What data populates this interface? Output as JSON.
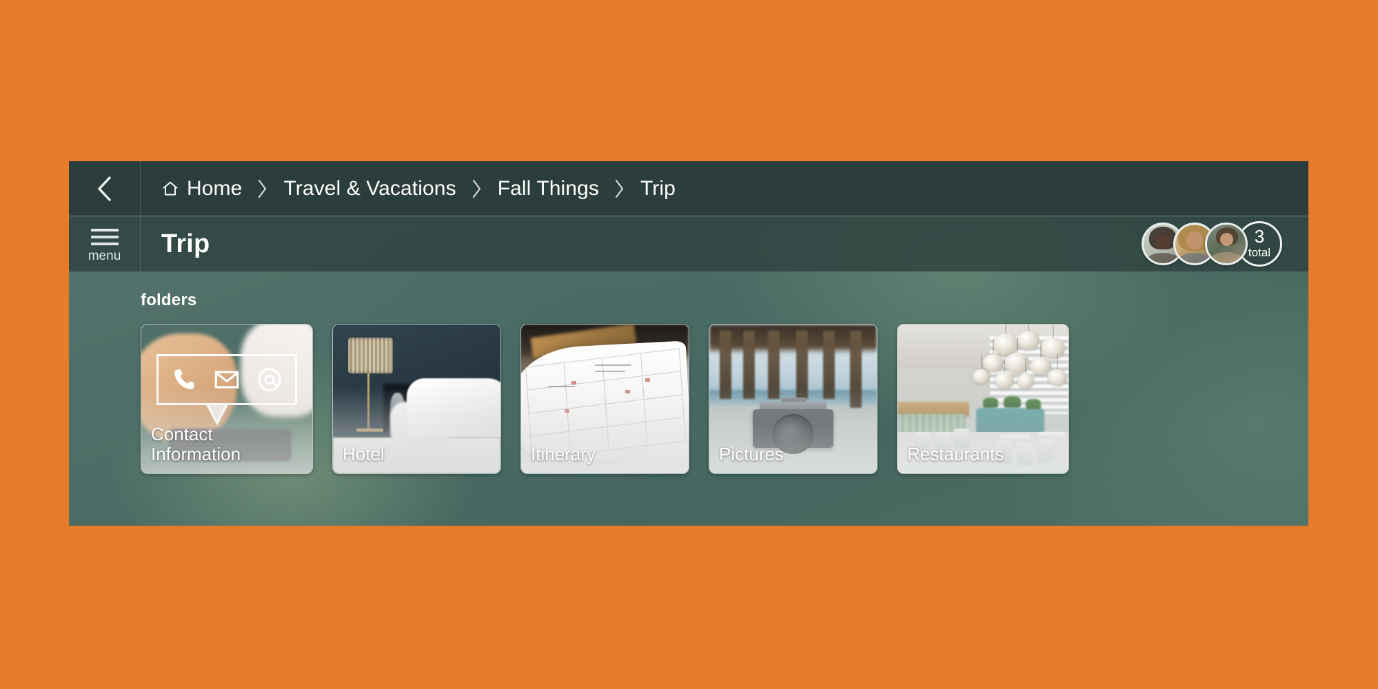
{
  "theme": {
    "page_background": "#e87a2b",
    "breadcrumb_background": "#2b3e3b",
    "title_bar_background": "#2e4440",
    "content_background": "#4b6b66",
    "text_color": "#ffffff"
  },
  "breadcrumb_bar": {
    "back_label": "Back",
    "items": [
      {
        "label": "Home",
        "icon": "home-icon"
      },
      {
        "label": "Travel & Vacations"
      },
      {
        "label": "Fall Things"
      },
      {
        "label": "Trip"
      }
    ],
    "separator": "›"
  },
  "title_bar": {
    "menu_label": "menu",
    "title": "Trip",
    "members": {
      "count": "3",
      "count_label": "total",
      "avatars": [
        {
          "name": "member-1"
        },
        {
          "name": "member-2"
        },
        {
          "name": "member-3"
        }
      ]
    }
  },
  "content": {
    "section_label": "folders",
    "folders": [
      {
        "label": "Contact\nInformation",
        "image": "hand-holding-phone",
        "icons": [
          "phone-icon",
          "envelope-icon",
          "at-icon"
        ]
      },
      {
        "label": "Hotel",
        "image": "hotel-bed-with-lamp"
      },
      {
        "label": "Itinerary",
        "image": "open-calendar-planner"
      },
      {
        "label": "Pictures",
        "image": "camera-on-beach-under-pier"
      },
      {
        "label": "Restaurants",
        "image": "restaurant-interior-pendant-lights"
      }
    ]
  }
}
